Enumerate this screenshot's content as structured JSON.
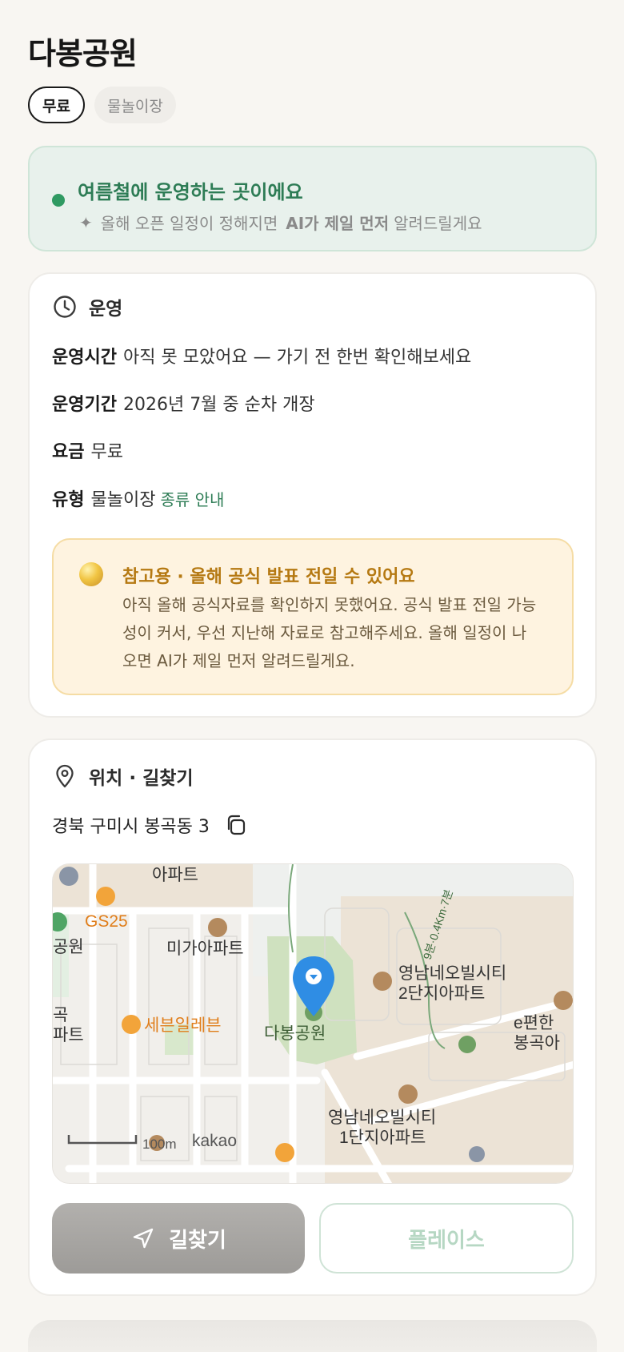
{
  "page": {
    "title": "다봉공원",
    "chips": [
      "무료",
      "물놀이장"
    ]
  },
  "season": {
    "title": "여름철에 운영하는 곳이에요",
    "sub_prefix": "올해 오픈 일정이 정해지면",
    "sub_strong": "AI가 제일 먼저",
    "sub_suffix": "알려드릴게요"
  },
  "operation": {
    "heading": "운영",
    "hours_label": "운영시간",
    "hours_value": "아직 못 모았어요 — 가기 전 한번 확인해보세요",
    "period_label": "운영기간",
    "period_value": "2026년 7월 중 순차 개장",
    "fee_label": "요금",
    "fee_value": "무료",
    "type_label": "유형",
    "type_value": "물놀이장",
    "type_link": "종류 안내",
    "notice_title": "참고용 · 올해 공식 발표 전일 수 있어요",
    "notice_body": "아직 올해 공식자료를 확인하지 못했어요. 공식 발표 전일 가능성이 커서, 우선 지난해 자료로 참고해주세요. 올해 일정이 나오면 AI가 제일 먼저 알려드릴게요."
  },
  "location": {
    "heading": "위치 · 길찾기",
    "address": "경북 구미시 봉곡동 3",
    "map_labels": {
      "apt_top": "아파트",
      "gs25": "GS25",
      "park_left": "공원",
      "miga": "미가아파트",
      "yn2_line1": "영남네오빌시티",
      "yn2_line2": "2단지아파트",
      "trail": "9분·0.4Km·7분",
      "ek_line1": "e편한",
      "ek_line2": "봉곡아",
      "seven": "세븐일레븐",
      "dabong": "다봉공원",
      "left_frag1": "곡",
      "left_frag2": "파트",
      "yn1_line1": "영남네오빌시티",
      "yn1_line2": "1단지아파트",
      "scale": "100m",
      "kakao": "kakao"
    },
    "nav_button": "길찾기",
    "place_button": "플레이스"
  },
  "colors": {
    "accent_green": "#2d7c55",
    "notice_amber": "#b57912",
    "marker_blue": "#2f8de4"
  }
}
